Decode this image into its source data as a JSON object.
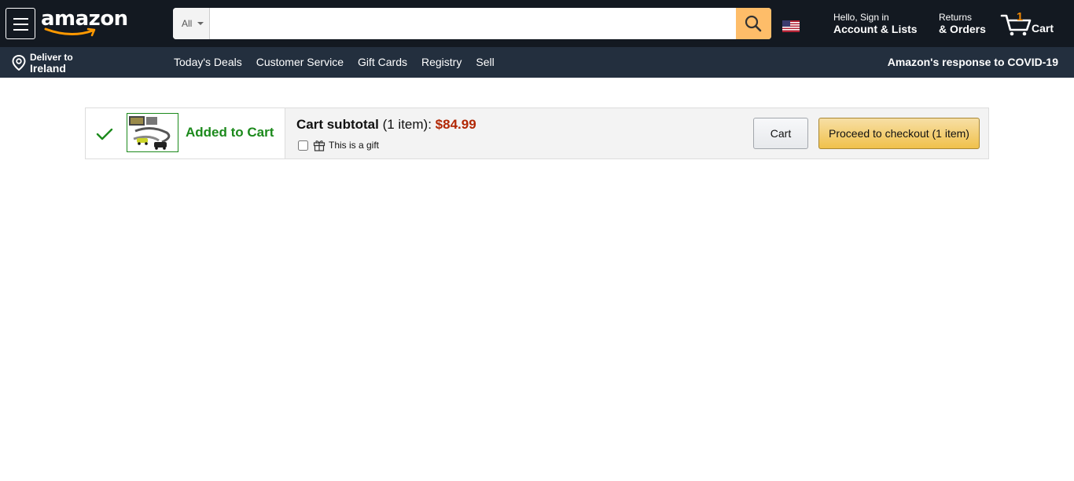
{
  "header": {
    "logo_text": "amazon",
    "search": {
      "department": "All",
      "placeholder": "",
      "value": ""
    },
    "account": {
      "greeting": "Hello, Sign in",
      "label": "Account & Lists"
    },
    "returns": {
      "line1": "Returns",
      "line2": "& Orders"
    },
    "cart": {
      "count": "1",
      "label": "Cart"
    }
  },
  "subnav": {
    "deliver_line1": "Deliver to",
    "deliver_line2": "Ireland",
    "links": [
      "Today's Deals",
      "Customer Service",
      "Gift Cards",
      "Registry",
      "Sell"
    ],
    "covid": "Amazon's response to COVID-19"
  },
  "added_to_cart": {
    "status": "Added to Cart",
    "subtotal_label": "Cart subtotal",
    "item_count": "(1 item):",
    "price": "$84.99",
    "gift_label": "This is a gift",
    "gift_checked": false,
    "cart_button": "Cart",
    "checkout_button": "Proceed to checkout (1 item)"
  },
  "colors": {
    "nav_dark": "#131921",
    "nav_sub": "#232f3e",
    "search_button": "#febd69",
    "success_green": "#1c8a1c",
    "price_red": "#b12704",
    "cart_count_orange": "#f08804"
  }
}
